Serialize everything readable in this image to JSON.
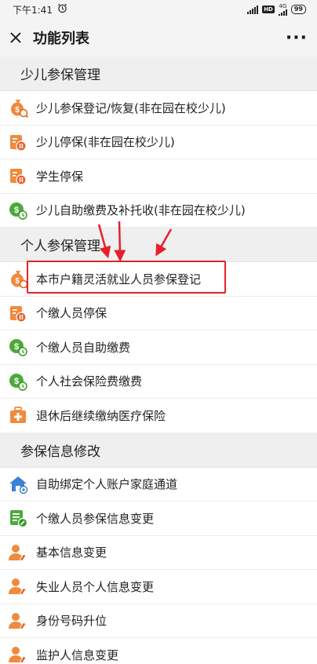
{
  "status_bar": {
    "time": "下午1:41",
    "network": "4G",
    "battery": "99"
  },
  "nav": {
    "title": "功能列表"
  },
  "sections": [
    {
      "header": "少儿参保管理",
      "items": [
        {
          "label": "少儿参保登记/恢复(非在园在校少儿)",
          "icon": "money-bag-icon"
        },
        {
          "label": "少儿停保(非在园在校少儿)",
          "icon": "pause-document-icon"
        },
        {
          "label": "学生停保",
          "icon": "pause-document-icon"
        },
        {
          "label": "少儿自助缴费及补托收(非在园在校少儿)",
          "icon": "coin-clock-icon"
        }
      ]
    },
    {
      "header": "个人参保管理",
      "items": [
        {
          "label": "本市户籍灵活就业人员参保登记",
          "icon": "money-bag-icon"
        },
        {
          "label": "个缴人员停保",
          "icon": "pause-document-icon"
        },
        {
          "label": "个缴人员自助缴费",
          "icon": "coin-clock-icon"
        },
        {
          "label": "个人社会保险费缴费",
          "icon": "coin-clock-icon"
        },
        {
          "label": "退休后继续缴纳医疗保险",
          "icon": "medical-kit-icon"
        }
      ]
    },
    {
      "header": "参保信息修改",
      "items": [
        {
          "label": "自助绑定个人账户家庭通道",
          "icon": "home-icon"
        },
        {
          "label": "个缴人员参保信息变更",
          "icon": "edit-list-icon"
        },
        {
          "label": "基本信息变更",
          "icon": "user-edit-icon"
        },
        {
          "label": "失业人员个人信息变更",
          "icon": "user-edit-icon"
        },
        {
          "label": "身份号码升位",
          "icon": "user-edit-icon"
        },
        {
          "label": "监护人信息变更",
          "icon": "user-edit-icon"
        }
      ]
    }
  ],
  "colors": {
    "orange": "#f08a3c",
    "green": "#4caa3a",
    "blue": "#3b82d6",
    "highlight": "#e5202a"
  }
}
